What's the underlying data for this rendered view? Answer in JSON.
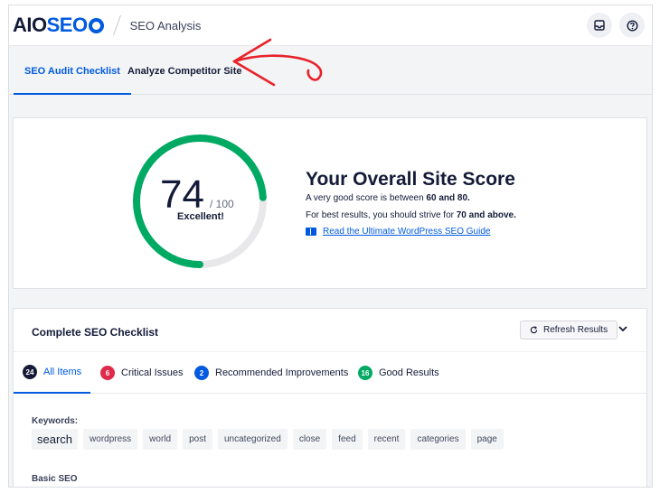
{
  "header": {
    "logo_aio": "AIO",
    "logo_seo": "SEO",
    "page_title": "SEO Analysis",
    "icons": [
      "inbox-icon",
      "help-icon"
    ]
  },
  "tabs": [
    {
      "label": "SEO Audit Checklist",
      "active": true
    },
    {
      "label": "Analyze Competitor Site",
      "active": false
    }
  ],
  "score": {
    "value": "74",
    "max": "/ 100",
    "value_numeric": 74,
    "max_numeric": 100,
    "label": "Excellent!",
    "heading": "Your Overall Site Score",
    "line1_pre": "A very good score is between ",
    "line1_bold": "60 and 80.",
    "line2_pre": "For best results, you should strive for ",
    "line2_bold": "70 and above.",
    "guide_link": "Read the Ultimate WordPress SEO Guide",
    "ring_color": "#00aa63",
    "track_color": "#e8e8eb"
  },
  "checklist": {
    "title": "Complete SEO Checklist",
    "refresh_label": "Refresh Results",
    "filters": [
      {
        "count": "24",
        "label": "All Items",
        "color": "#141b38",
        "active": true
      },
      {
        "count": "6",
        "label": "Critical Issues",
        "color": "#df2a4a",
        "active": false
      },
      {
        "count": "2",
        "label": "Recommended Improvements",
        "color": "#005ae0",
        "active": false
      },
      {
        "count": "16",
        "label": "Good Results",
        "color": "#00aa63",
        "active": false
      }
    ],
    "keywords_label": "Keywords:",
    "keywords": [
      "search",
      "wordpress",
      "world",
      "post",
      "uncategorized",
      "close",
      "feed",
      "recent",
      "categories",
      "page"
    ],
    "basic_seo_label": "Basic SEO"
  },
  "colors": {
    "accent": "#005ae0",
    "annotation_arrow": "#e8222b"
  }
}
